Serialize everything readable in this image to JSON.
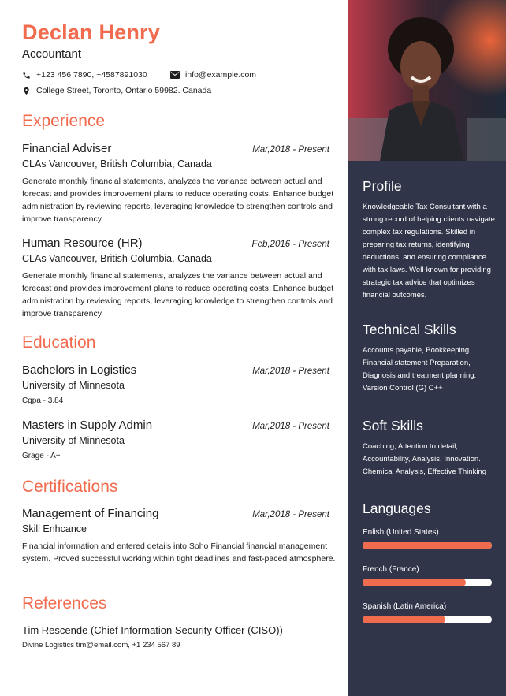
{
  "header": {
    "name": "Declan Henry",
    "role": "Accountant",
    "phone": "+123 456 7890, +4587891030",
    "email": "info@example.com",
    "address": "College Street, Toronto, Ontario 59982. Canada"
  },
  "experience": {
    "title": "Experience",
    "items": [
      {
        "title": "Financial Adviser",
        "date": "Mar,2018 - Present",
        "location": "CLAs Vancouver, British Columbia, Canada",
        "description": "Generate monthly financial statements, analyzes the variance between actual and forecast and provides improvement plans to reduce operating costs. Enhance budget administration by reviewing reports, leveraging knowledge to strengthen controls and improve transparency."
      },
      {
        "title": "Human Resource (HR)",
        "date": "Feb,2016 - Present",
        "location": "CLAs Vancouver, British Columbia, Canada",
        "description": "Generate monthly financial statements, analyzes the variance between actual and forecast and provides improvement plans to reduce operating costs. Enhance budget administration by reviewing reports, leveraging knowledge to strengthen controls and improve transparency."
      }
    ]
  },
  "education": {
    "title": "Education",
    "items": [
      {
        "title": "Bachelors in Logistics",
        "date": "Mar,2018 - Present",
        "school": "University of Minnesota",
        "grade": "Cgpa - 3.84"
      },
      {
        "title": "Masters in Supply Admin",
        "date": "Mar,2018 - Present",
        "school": "University of Minnesota",
        "grade": "Grage - A+"
      }
    ]
  },
  "certifications": {
    "title": "Certifications",
    "items": [
      {
        "title": "Management of Financing",
        "date": "Mar,2018 - Present",
        "subtitle": "Skill Enhcance",
        "description": "Financial information and entered details into Soho Financial financial management system. Proved successful working within tight deadlines and fast-paced atmosphere."
      }
    ]
  },
  "references": {
    "title": "References",
    "name": "Tim Rescende (Chief Information Security Officer (CISO))",
    "detail": "Divine Logistics  tim@email.com, +1 234 567 89"
  },
  "sidebar": {
    "profile": {
      "title": "Profile",
      "text": "Knowledgeable Tax Consultant with a strong record of helping clients navigate complex tax regulations. Skilled in preparing tax returns, identifying deductions, and ensuring compliance with tax laws. Well-known for providing strategic tax advice that optimizes financial outcomes."
    },
    "technical": {
      "title": "Technical Skills",
      "text": "Accounts payable, Bookkeeping Financial statement Preparation, Diagnosis and treatment planning. Varsion Control (G) C++"
    },
    "soft": {
      "title": "Soft Skills",
      "text": "Coaching, Attention to detail, Accountability, Analysis, Innovation. Chemical Analysis, Effective Thinking"
    },
    "languages": {
      "title": "Languages",
      "items": [
        {
          "name": "Enlish (United States)",
          "level": 1.0
        },
        {
          "name": "French (France)",
          "level": 0.8
        },
        {
          "name": "Spanish (Latin America)",
          "level": 0.64
        }
      ]
    }
  },
  "colors": {
    "accent": "#f16b4e",
    "sidebar": "#31354a"
  },
  "icons": {
    "phone": "phone-icon",
    "email": "envelope-icon",
    "address": "location-pin-icon"
  }
}
